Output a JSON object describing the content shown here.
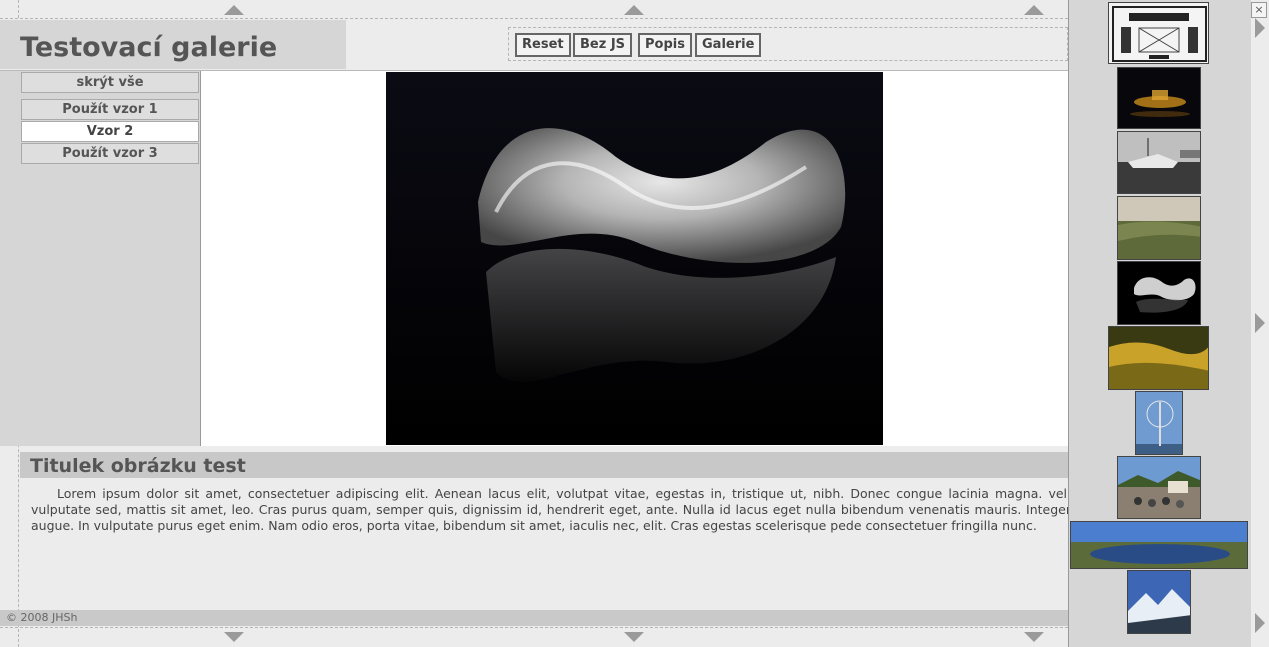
{
  "header": {
    "title": "Testovací galerie"
  },
  "toolbar": {
    "reset": "Reset",
    "nojs": "Bez JS",
    "popis": "Popis",
    "galerie": "Galerie"
  },
  "sidebar": {
    "hide_all": "skrýt vše",
    "items": [
      "Použít vzor 1",
      "Vzor 2",
      "Použít vzor 3"
    ],
    "active_index": 1
  },
  "caption": {
    "title": "Titulek obrázku test",
    "text": "Lorem ipsum dolor sit amet, consectetuer adipiscing elit. Aenean lacus elit, volutpat vitae, egestas in, tristique ut, nibh. Donec congue lacinia magna. vel, vulputate sed, mattis sit amet, leo. Cras purus quam, semper quis, dignissim id, hendrerit eget, ante. Nulla id lacus eget nulla bibendum venenatis mauris. Integer augue. In vulputate purus eget enim. Nam odio eros, porta vitae, bibendum sit amet, iaculis nec, elit. Cras egestas scelerisque pede consectetuer fringilla nunc."
  },
  "footer": {
    "copyright": "© 2008 JHSh"
  },
  "close_glyph": "×",
  "colors": {
    "accent": "#555555",
    "panel": "#d6d6d6",
    "bg": "#ececec"
  },
  "thumbnails": [
    {
      "name": "test-chart"
    },
    {
      "name": "night-castle"
    },
    {
      "name": "boats-harbor"
    },
    {
      "name": "landscape-hills"
    },
    {
      "name": "glass-sculpture",
      "selected": true
    },
    {
      "name": "golden-grass"
    },
    {
      "name": "birch-tree"
    },
    {
      "name": "crowd-square"
    },
    {
      "name": "lake-panorama"
    },
    {
      "name": "snowy-mountains"
    }
  ]
}
